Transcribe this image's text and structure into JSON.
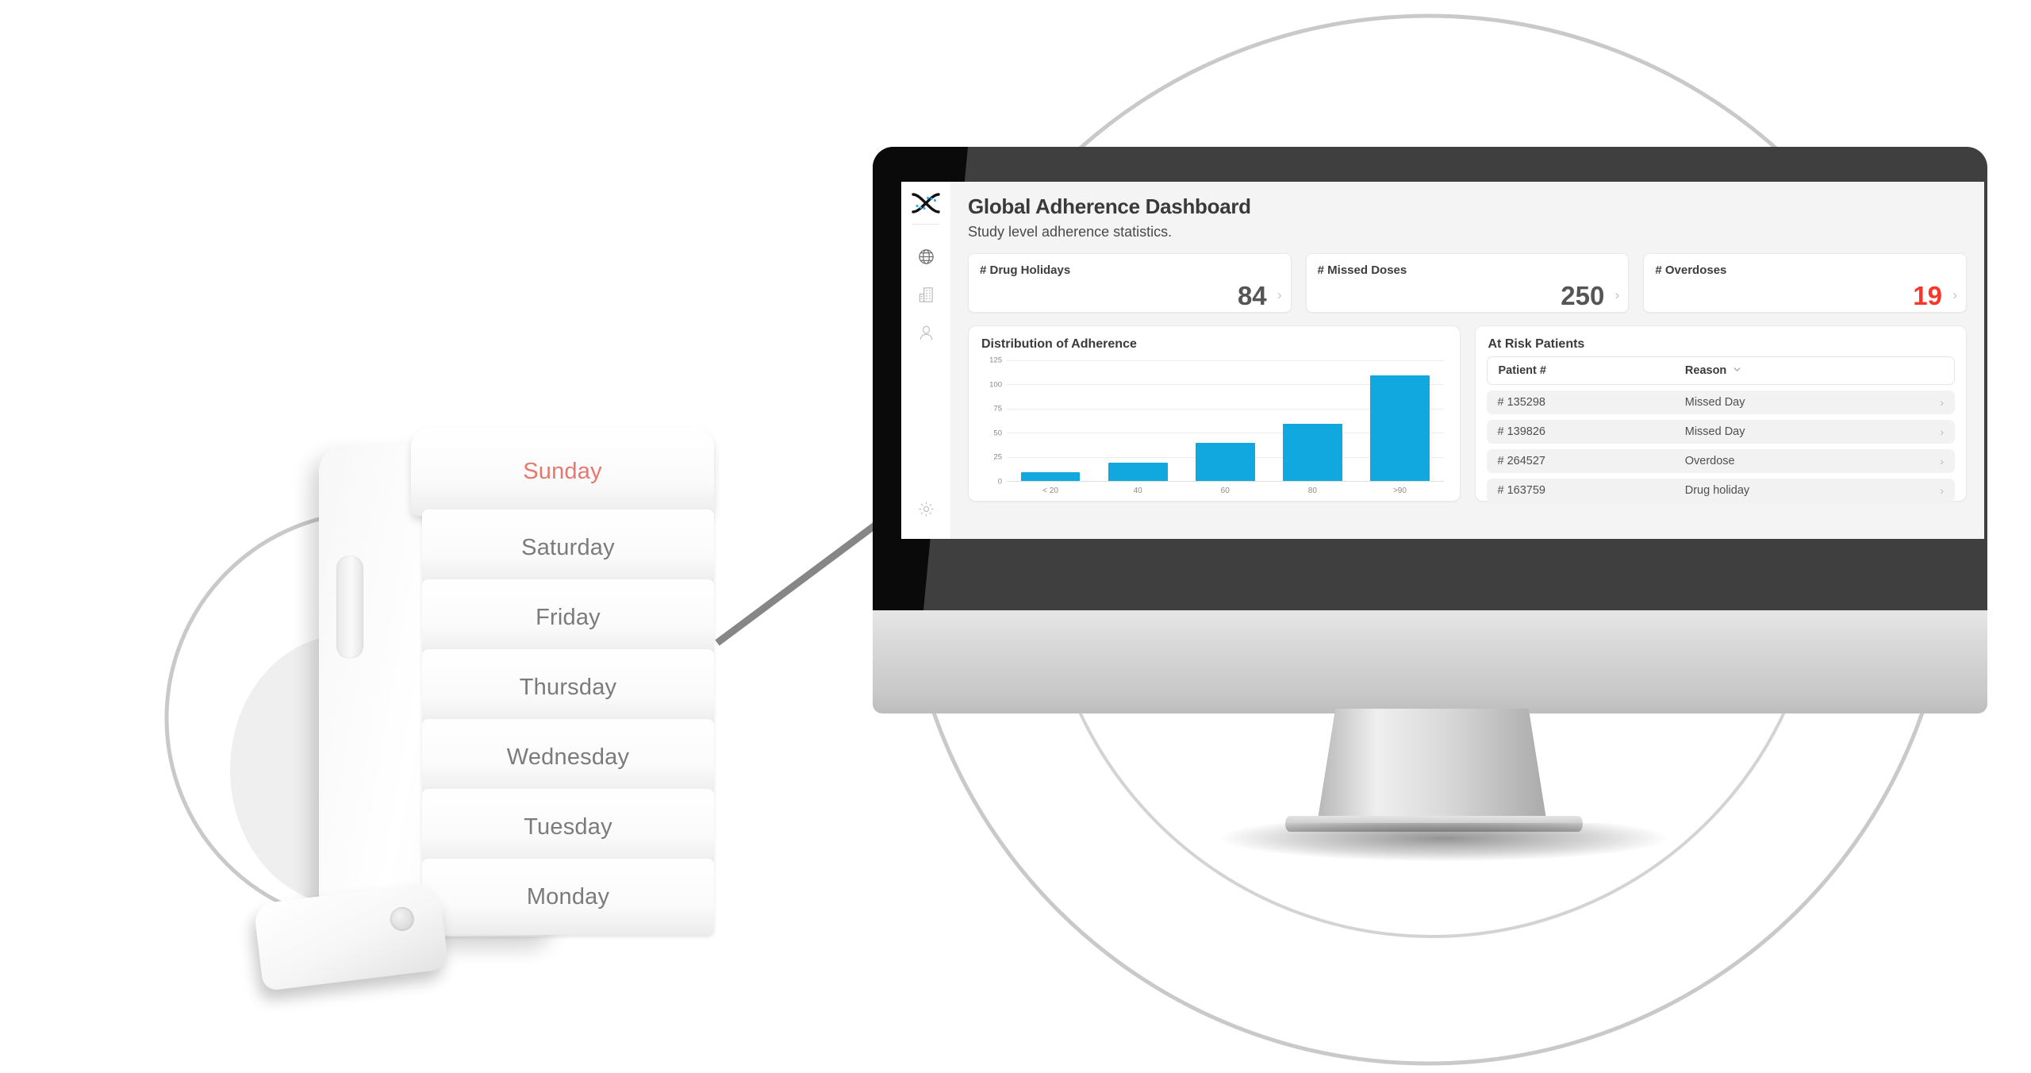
{
  "app": {
    "logo_icon": "dna-helix-logo",
    "accent_blue": "#11a8e0",
    "danger_red": "#f8372b"
  },
  "sidebar": {
    "items": [
      {
        "icon": "globe-icon",
        "name": "sidebar-item-global"
      },
      {
        "icon": "building-icon",
        "name": "sidebar-item-sites"
      },
      {
        "icon": "person-icon",
        "name": "sidebar-item-patients"
      }
    ],
    "settings": {
      "icon": "gear-icon",
      "name": "sidebar-item-settings"
    }
  },
  "header": {
    "title": "Global Adherence Dashboard",
    "subtitle": "Study level adherence statistics."
  },
  "stats": [
    {
      "label": "# Drug Holidays",
      "value": "84",
      "danger": false,
      "chevron": "›"
    },
    {
      "label": "# Missed Doses",
      "value": "250",
      "danger": false,
      "chevron": "›"
    },
    {
      "label": "# Overdoses",
      "value": "19",
      "danger": true,
      "chevron": "›"
    }
  ],
  "chart_panel": {
    "title": "Distribution of Adherence"
  },
  "chart_data": {
    "type": "bar",
    "title": "Distribution of Adherence",
    "categories": [
      "< 20",
      "40",
      "60",
      "80",
      ">90"
    ],
    "values": [
      10,
      20,
      40,
      60,
      110
    ],
    "xlabel": "",
    "ylabel": "",
    "ylim": [
      0,
      125
    ],
    "yticks": [
      0,
      25,
      50,
      75,
      100,
      125
    ],
    "grid": true,
    "legend": "none",
    "bar_color": "#11a8e0"
  },
  "patients_panel": {
    "title": "At Risk Patients",
    "columns": [
      "Patient #",
      "Reason"
    ],
    "sort_icon": "chevron-down-icon",
    "rows": [
      {
        "patient": "# 135298",
        "reason": "Missed Day",
        "chevron": "›"
      },
      {
        "patient": "# 139826",
        "reason": "Missed Day",
        "chevron": "›"
      },
      {
        "patient": "# 264527",
        "reason": "Overdose",
        "chevron": "›"
      },
      {
        "patient": "# 163759",
        "reason": "Drug holiday",
        "chevron": "›"
      }
    ]
  },
  "device": {
    "trays": [
      {
        "day": "Sunday",
        "today": true
      },
      {
        "day": "Saturday",
        "today": false
      },
      {
        "day": "Friday",
        "today": false
      },
      {
        "day": "Thursday",
        "today": false
      },
      {
        "day": "Wednesday",
        "today": false
      },
      {
        "day": "Tuesday",
        "today": false
      },
      {
        "day": "Monday",
        "today": false
      }
    ],
    "today_color": "#e8786e"
  }
}
